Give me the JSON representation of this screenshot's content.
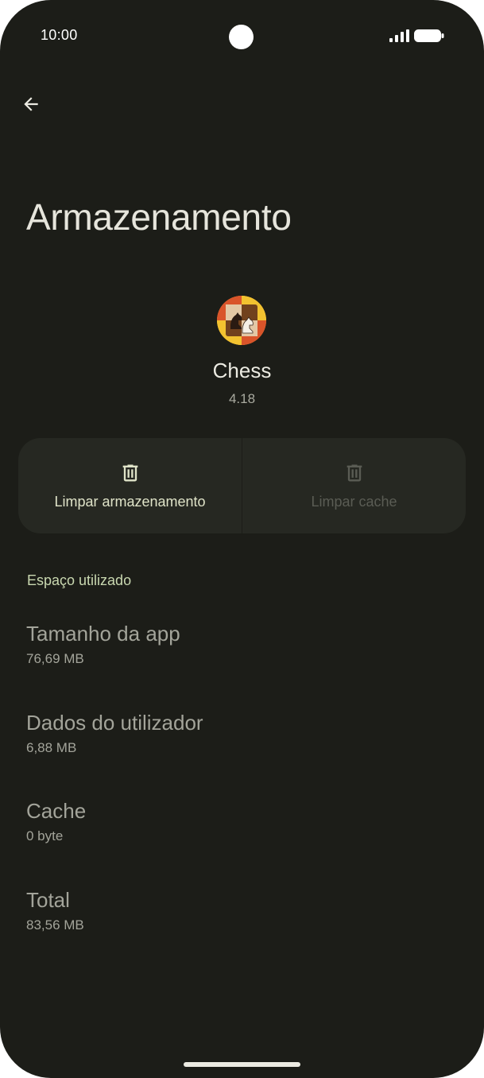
{
  "status_bar": {
    "time": "10:00"
  },
  "header": {
    "back_icon": "arrow-back-icon",
    "title": "Armazenamento"
  },
  "app": {
    "icon": "chess-app-icon",
    "name": "Chess",
    "version": "4.18"
  },
  "actions": {
    "clear_storage_label": "Limpar armazenamento",
    "clear_storage_icon": "trash-icon",
    "clear_cache_label": "Limpar cache",
    "clear_cache_icon": "trash-icon",
    "clear_cache_enabled": false
  },
  "storage": {
    "section_title": "Espaço utilizado",
    "items": [
      {
        "label": "Tamanho da app",
        "value": "76,69 MB"
      },
      {
        "label": "Dados do utilizador",
        "value": "6,88 MB"
      },
      {
        "label": "Cache",
        "value": "0 byte"
      },
      {
        "label": "Total",
        "value": "83,56 MB"
      }
    ]
  },
  "colors": {
    "background": "#1c1d18",
    "card": "#262822",
    "accent_text": "#c9d8b0",
    "disabled_text": "#5a5c54"
  }
}
